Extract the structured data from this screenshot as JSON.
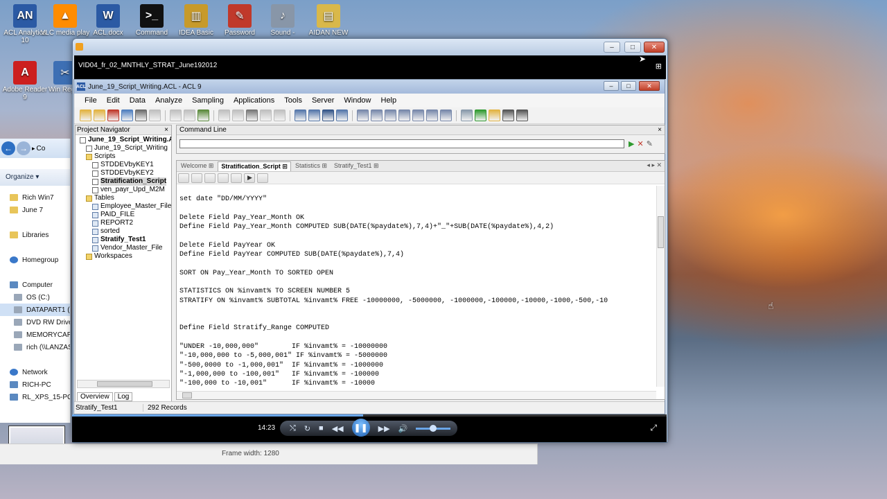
{
  "desktop": {
    "icons": [
      {
        "label": "ACL Analytics 10",
        "glyph": "AN",
        "color": "#2b5aa4"
      },
      {
        "label": "VLC media play",
        "glyph": "▲",
        "color": "#ff8c00"
      },
      {
        "label": "ACL.docx",
        "glyph": "W",
        "color": "#2b5aa4"
      },
      {
        "label": "Command",
        "glyph": ">_",
        "color": "#111111"
      },
      {
        "label": "IDEA Basic",
        "glyph": "▥",
        "color": "#c79a2b"
      },
      {
        "label": "Password",
        "glyph": "✎",
        "color": "#c0392b"
      },
      {
        "label": "Sound -",
        "glyph": "♪",
        "color": "#8896a8"
      },
      {
        "label": "AIDAN NEW",
        "glyph": "▤",
        "color": "#d9b84a"
      },
      {
        "label": "Adobe Reader 9",
        "glyph": "A",
        "color": "#cc1f1f"
      },
      {
        "label": "Win Regist",
        "glyph": "✂",
        "color": "#3d6fb4"
      }
    ]
  },
  "explorer": {
    "address_fragment": "Co",
    "organize_label": "Organize ▾",
    "items": [
      {
        "label": "Rich Win7",
        "icon": "folder"
      },
      {
        "label": "June 7",
        "icon": "folder"
      },
      {
        "label": "",
        "icon": ""
      },
      {
        "label": "Libraries",
        "icon": "folder"
      },
      {
        "label": "",
        "icon": ""
      },
      {
        "label": "Homegroup",
        "icon": "net"
      },
      {
        "label": "",
        "icon": ""
      },
      {
        "label": "Computer",
        "icon": "comp"
      },
      {
        "label": "OS (C:)",
        "icon": "drive"
      },
      {
        "label": "DATAPART1 (D",
        "icon": "drive"
      },
      {
        "label": "DVD RW Drive",
        "icon": "drive"
      },
      {
        "label": "MEMORYCARD",
        "icon": "drive"
      },
      {
        "label": "rich (\\\\LANZAS",
        "icon": "drive"
      },
      {
        "label": "",
        "icon": ""
      },
      {
        "label": "Network",
        "icon": "net"
      },
      {
        "label": "RICH-PC",
        "icon": "comp"
      },
      {
        "label": "RL_XPS_15-PC",
        "icon": "comp"
      }
    ],
    "frame_width_label": "Frame width: 1280"
  },
  "player": {
    "title": "VID04_fr_02_MNTHLY_STRAT_June192012",
    "time": "14:23",
    "progress": 0.49
  },
  "acl": {
    "title": "June_19_Script_Writing.ACL - ACL 9",
    "menu": [
      "File",
      "Edit",
      "Data",
      "Analyze",
      "Sampling",
      "Applications",
      "Tools",
      "Server",
      "Window",
      "Help"
    ],
    "navigator": {
      "title": "Project Navigator",
      "close": "×",
      "tree": [
        {
          "label": "June_19_Script_Writing.ACL",
          "level": 0,
          "icon": "script",
          "bold": true
        },
        {
          "label": "June_19_Script_Writing",
          "level": 1,
          "icon": "script"
        },
        {
          "label": "Scripts",
          "level": 1,
          "icon": "folder"
        },
        {
          "label": "STDDEVbyKEY1",
          "level": 2,
          "icon": "script"
        },
        {
          "label": "STDDEVbyKEY2",
          "level": 2,
          "icon": "script"
        },
        {
          "label": "Stratification_Script",
          "level": 2,
          "icon": "script",
          "bold": true,
          "highlight": true
        },
        {
          "label": "ven_payr_Upd_M2M",
          "level": 2,
          "icon": "script"
        },
        {
          "label": "Tables",
          "level": 1,
          "icon": "folder"
        },
        {
          "label": "Employee_Master_File",
          "level": 2,
          "icon": "table"
        },
        {
          "label": "PAID_FILE",
          "level": 2,
          "icon": "table"
        },
        {
          "label": "REPORT2",
          "level": 2,
          "icon": "table"
        },
        {
          "label": "sorted",
          "level": 2,
          "icon": "table"
        },
        {
          "label": "Stratify_Test1",
          "level": 2,
          "icon": "table",
          "bold": true
        },
        {
          "label": "Vendor_Master_File",
          "level": 2,
          "icon": "table"
        },
        {
          "label": "Workspaces",
          "level": 1,
          "icon": "folder"
        }
      ],
      "tabs": [
        "Overview",
        "Log"
      ]
    },
    "command_line": {
      "title": "Command Line",
      "close": "×",
      "value": ""
    },
    "editor": {
      "tabs": [
        "Welcome",
        "Stratification_Script",
        "Statistics",
        "Stratify_Test1"
      ],
      "active_tab": 1,
      "lines": [
        "               ",
        "set date \"DD/MM/YYYY\"",
        "",
        "Delete Field Pay_Year_Month OK",
        "Define Field Pay_Year_Month COMPUTED SUB(DATE(%paydate%),7,4)+\"_\"+SUB(DATE(%paydate%),4,2)",
        "",
        "Delete Field PayYear OK",
        "Define Field PayYear COMPUTED SUB(DATE(%paydate%),7,4)",
        "",
        "SORT ON Pay_Year_Month TO SORTED OPEN",
        "",
        "STATISTICS ON %invamt% TO SCREEN NUMBER 5",
        "STRATIFY ON %invamt% SUBTOTAL %invamt% FREE -10000000, -5000000, -1000000,-100000,-10000,-1000,-500,-10",
        "",
        "",
        "Define Field Stratify_Range COMPUTED",
        "",
        "\"UNDER -10,000,000\"        IF %invamt% = -10000000",
        "\"-10,000,000 to -5,000,001\" IF %invamt% = -5000000",
        "\"-500,0000 to -1,000,001\"  IF %invamt% = -1000000",
        "\"-1,000,000 to -100,001\"   IF %invamt% = -100000",
        "\"-100,000 to -10,001\"      IF %invamt% = -10000"
      ]
    },
    "status": {
      "table": "Stratify_Test1",
      "records": "292 Records"
    }
  }
}
